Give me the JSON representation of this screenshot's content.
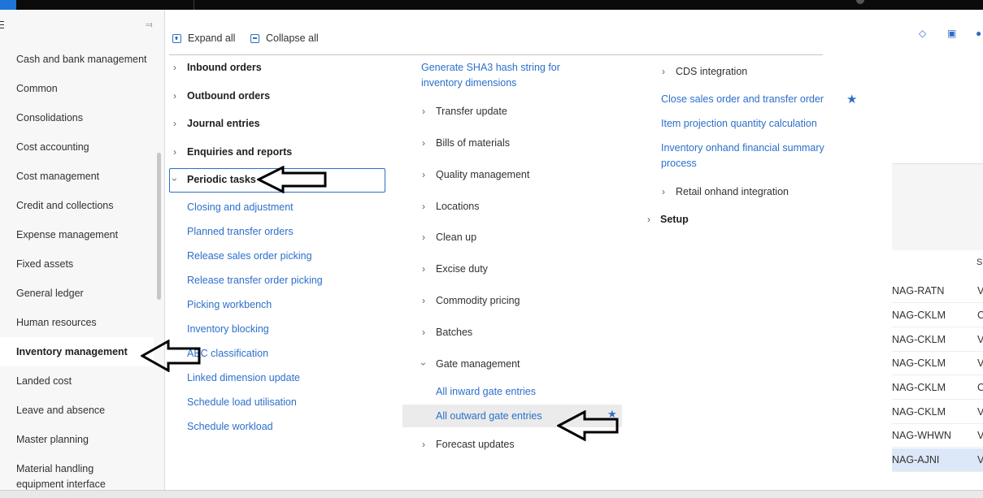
{
  "leftnav": {
    "modules": [
      "Cash and bank management",
      "Common",
      "Consolidations",
      "Cost accounting",
      "Cost management",
      "Credit and collections",
      "Expense management",
      "Fixed assets",
      "General ledger",
      "Human resources",
      "Inventory management",
      "Landed cost",
      "Leave and absence",
      "Master planning",
      "Material handling",
      "equipment interface"
    ],
    "selected": "Inventory management"
  },
  "toolbar": {
    "expand_all": "Expand all",
    "collapse_all": "Collapse all"
  },
  "column1": {
    "groups": [
      "Inbound orders",
      "Outbound orders",
      "Journal entries",
      "Enquiries and reports"
    ],
    "periodic_tasks": "Periodic tasks",
    "links": [
      "Closing and adjustment",
      "Planned transfer orders",
      "Release sales order picking",
      "Release transfer order picking",
      "Picking workbench",
      "Inventory blocking",
      "ABC classification",
      "Linked dimension update",
      "Schedule load utilisation",
      "Schedule workload"
    ]
  },
  "column2": {
    "sha3_link_line1": "Generate SHA3 hash string for",
    "sha3_link_line2": "inventory dimensions",
    "groups": [
      "Transfer update",
      "Bills of materials",
      "Quality management",
      "Locations",
      "Clean up",
      "Excise duty",
      "Commodity pricing",
      "Batches"
    ],
    "gate_management": "Gate management",
    "gate_links": [
      "All inward gate entries",
      "All outward gate entries"
    ],
    "forecast_updates": "Forecast updates"
  },
  "column3": {
    "cds_integration": "CDS integration",
    "close_link": "Close sales order and transfer order",
    "item_projection": "Item projection quantity calculation",
    "onhand_line1": "Inventory onhand financial summary",
    "onhand_line2": "process",
    "retail_onhand": "Retail onhand integration",
    "setup": "Setup"
  },
  "background_page": {
    "header_fragment": "S",
    "rows": [
      {
        "code": "NAG-RATN",
        "status": "V"
      },
      {
        "code": "NAG-CKLM",
        "status": "C"
      },
      {
        "code": "NAG-CKLM",
        "status": "V"
      },
      {
        "code": "NAG-CKLM",
        "status": "V"
      },
      {
        "code": "NAG-CKLM",
        "status": "C"
      },
      {
        "code": "NAG-CKLM",
        "status": "V"
      },
      {
        "code": "NAG-WHWN",
        "status": "V"
      },
      {
        "code": "NAG-AJNI",
        "status": "V"
      }
    ]
  },
  "colors": {
    "link": "#2c6fcb",
    "accent": "#2f6ec5",
    "nav_background": "#f7f7f7"
  }
}
